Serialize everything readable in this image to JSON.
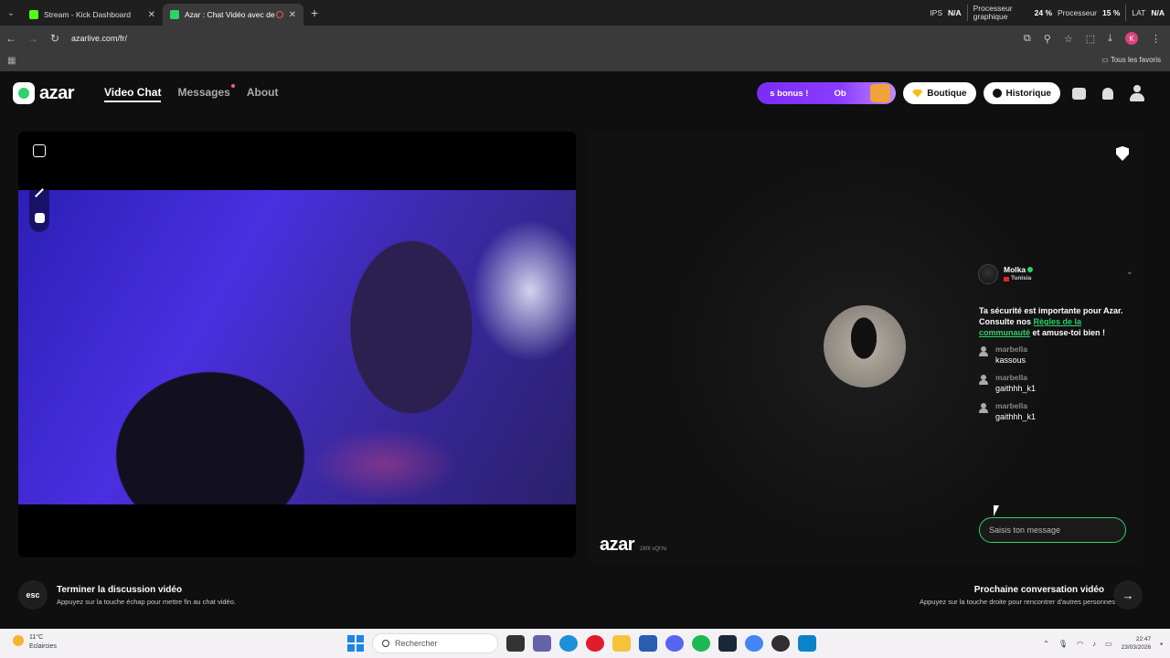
{
  "browser": {
    "tabs": [
      {
        "title": "Stream - Kick Dashboard",
        "active": false,
        "favicon_color": "#53fc18"
      },
      {
        "title": "Azar : Chat Vidéo avec de n",
        "active": true,
        "favicon_color": "#2ad36b"
      }
    ],
    "stats": {
      "ips_label": "IPS",
      "ips_value": "N/A",
      "gpu_label_1": "Processeur",
      "gpu_label_2": "graphique",
      "gpu_value": "24 %",
      "cpu_label": "Processeur",
      "cpu_value": "15 %",
      "lat_label": "LAT",
      "lat_value": "N/A"
    },
    "url": "azarlive.com/fr/",
    "profile_initial": "K",
    "bookmarks_all": "Tous les favoris"
  },
  "site": {
    "logo_text": "azar",
    "nav": [
      {
        "label": "Video Chat",
        "active": true
      },
      {
        "label": "Messages",
        "active": false,
        "has_dot": true
      },
      {
        "label": "About",
        "active": false
      }
    ],
    "bonus_text_1": "s bonus !",
    "bonus_text_2": "Ob",
    "boutique_label": "Boutique",
    "historique_label": "Historique"
  },
  "partner": {
    "name": "Molka",
    "country": "Tunisia",
    "brand_watermark": "azar",
    "brand_code": "280t vQtYe"
  },
  "chat": {
    "safety_pre": "Ta sécurité est importante pour Azar. Consulte nos ",
    "safety_link": "Règles de la communauté",
    "safety_post": " et amuse-toi bien !",
    "messages": [
      {
        "user": "marbella",
        "text": "kassous"
      },
      {
        "user": "marbella",
        "text": "gaithhh_k1"
      },
      {
        "user": "marbella",
        "text": "gaithhh_k1"
      }
    ],
    "input_placeholder": "Saisis ton message"
  },
  "bottom": {
    "esc_key": "esc",
    "end_title": "Terminer la discussion vidéo",
    "end_sub": "Appuyez sur la touche échap pour mettre fin au chat vidéo.",
    "next_title": "Prochaine conversation vidéo",
    "next_sub": "Appuyez sur la touche droite pour rencontrer d'autres personnes",
    "next_arrow": "→"
  },
  "taskbar": {
    "weather_temp": "11°C",
    "weather_desc": "Eclaircies",
    "search_placeholder": "Rechercher",
    "time": "22:47",
    "date": "23/03/2026"
  }
}
